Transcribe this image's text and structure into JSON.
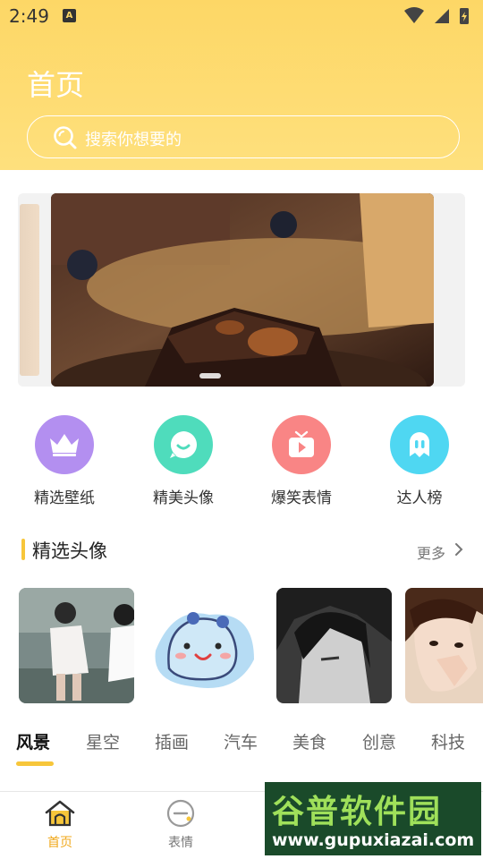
{
  "status_bar": {
    "time": "2:49",
    "notification": "A"
  },
  "header": {
    "title": "首页",
    "search_placeholder": "搜索你想要的"
  },
  "categories": [
    {
      "label": "精选壁纸",
      "icon": "crown-icon",
      "color": "#b38ff0"
    },
    {
      "label": "精美头像",
      "icon": "chat-bubble-icon",
      "color": "#4fdcbc"
    },
    {
      "label": "爆笑表情",
      "icon": "video-play-icon",
      "color": "#f98585"
    },
    {
      "label": "达人榜",
      "icon": "ghost-icon",
      "color": "#4fd7f2"
    }
  ],
  "section": {
    "title": "精选头像",
    "more": "更多"
  },
  "tabs": [
    "风景",
    "星空",
    "插画",
    "汽车",
    "美食",
    "创意",
    "科技"
  ],
  "bottom_nav": [
    {
      "label": "首页",
      "icon": "home-icon",
      "active": true
    },
    {
      "label": "表情",
      "icon": "emoji-icon",
      "active": false
    }
  ],
  "watermark": {
    "line1": "谷普软件园",
    "line2": "www.gupuxiazai.com"
  },
  "colors": {
    "accent": "#f7c63a",
    "nav_active": "#f0a81c"
  }
}
